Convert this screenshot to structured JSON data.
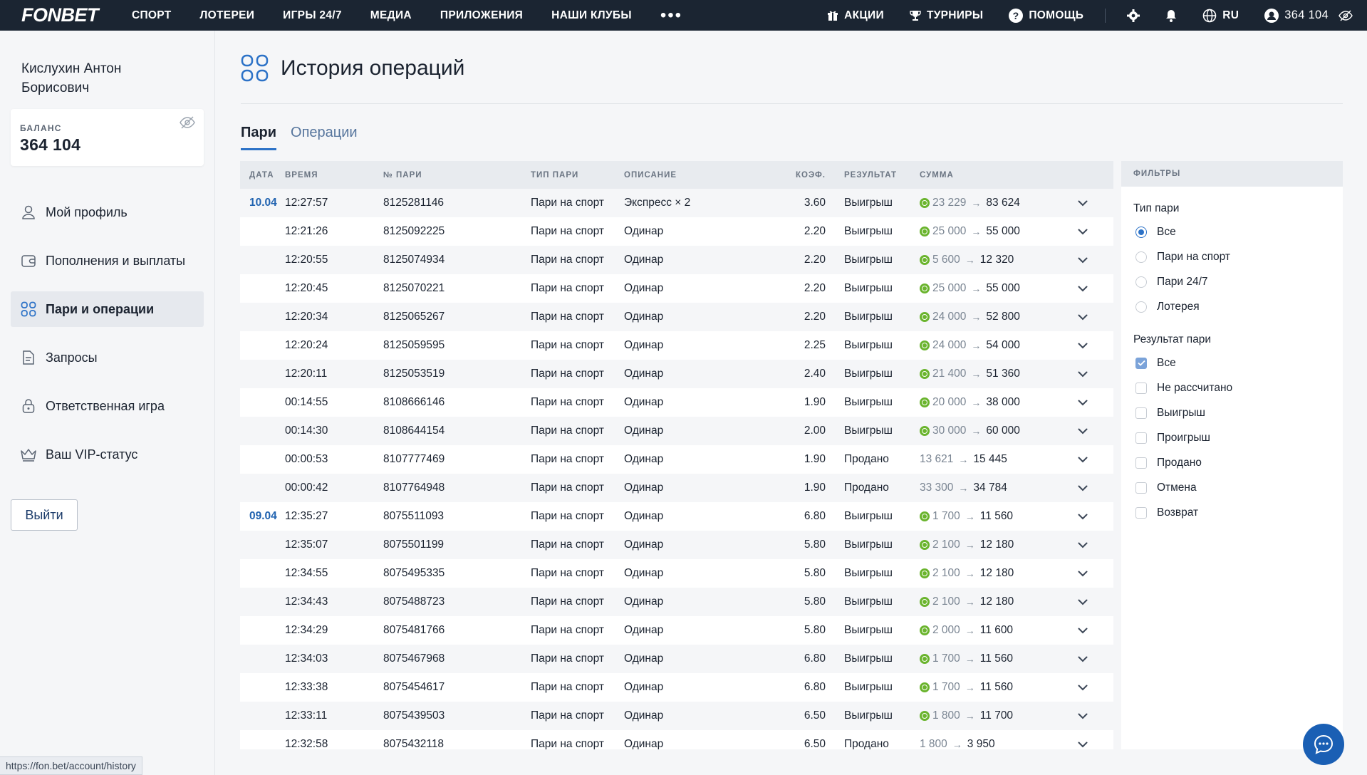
{
  "topbar": {
    "logo": "FONBET",
    "nav": [
      "СПОРТ",
      "ЛОТЕРЕИ",
      "ИГРЫ 24/7",
      "МЕДИА",
      "ПРИЛОЖЕНИЯ",
      "НАШИ КЛУБЫ"
    ],
    "more": "•••",
    "promos": "АКЦИИ",
    "tournaments": "ТУРНИРЫ",
    "help": "ПОМОЩЬ",
    "lang": "RU",
    "balance": "364 104"
  },
  "sidebar": {
    "user_name": "Кислухин Антон Борисович",
    "balance_label": "БАЛАНС",
    "balance_value": "364 104",
    "menu": [
      {
        "label": "Мой профиль",
        "icon": "user-icon"
      },
      {
        "label": "Пополнения и выплаты",
        "icon": "wallet-icon"
      },
      {
        "label": "Пари и операции",
        "icon": "grid-icon",
        "active": true
      },
      {
        "label": "Запросы",
        "icon": "document-icon"
      },
      {
        "label": "Ответственная игра",
        "icon": "lock-icon"
      },
      {
        "label": "Ваш VIP-статус",
        "icon": "crown-icon"
      }
    ],
    "logout": "Выйти"
  },
  "page": {
    "title": "История операций",
    "tabs": [
      "Пари",
      "Операции"
    ]
  },
  "table": {
    "headers": [
      "ДАТА",
      "ВРЕМЯ",
      "№ ПАРИ",
      "ТИП ПАРИ",
      "ОПИСАНИЕ",
      "КОЭФ.",
      "РЕЗУЛЬТАТ",
      "СУММА"
    ],
    "rows": [
      {
        "date": "10.04",
        "time": "12:27:57",
        "num": "8125281146",
        "type": "Пари на спорт",
        "desc": "Экспресс × 2",
        "coef": "3.60",
        "result": "Выигрыш",
        "stake": "23 229",
        "payout": "83 624",
        "bonus": true
      },
      {
        "date": "",
        "time": "12:21:26",
        "num": "8125092225",
        "type": "Пари на спорт",
        "desc": "Одинар",
        "coef": "2.20",
        "result": "Выигрыш",
        "stake": "25 000",
        "payout": "55 000",
        "bonus": true
      },
      {
        "date": "",
        "time": "12:20:55",
        "num": "8125074934",
        "type": "Пари на спорт",
        "desc": "Одинар",
        "coef": "2.20",
        "result": "Выигрыш",
        "stake": "5 600",
        "payout": "12 320",
        "bonus": true
      },
      {
        "date": "",
        "time": "12:20:45",
        "num": "8125070221",
        "type": "Пари на спорт",
        "desc": "Одинар",
        "coef": "2.20",
        "result": "Выигрыш",
        "stake": "25 000",
        "payout": "55 000",
        "bonus": true
      },
      {
        "date": "",
        "time": "12:20:34",
        "num": "8125065267",
        "type": "Пари на спорт",
        "desc": "Одинар",
        "coef": "2.20",
        "result": "Выигрыш",
        "stake": "24 000",
        "payout": "52 800",
        "bonus": true
      },
      {
        "date": "",
        "time": "12:20:24",
        "num": "8125059595",
        "type": "Пари на спорт",
        "desc": "Одинар",
        "coef": "2.25",
        "result": "Выигрыш",
        "stake": "24 000",
        "payout": "54 000",
        "bonus": true
      },
      {
        "date": "",
        "time": "12:20:11",
        "num": "8125053519",
        "type": "Пари на спорт",
        "desc": "Одинар",
        "coef": "2.40",
        "result": "Выигрыш",
        "stake": "21 400",
        "payout": "51 360",
        "bonus": true
      },
      {
        "date": "",
        "time": "00:14:55",
        "num": "8108666146",
        "type": "Пари на спорт",
        "desc": "Одинар",
        "coef": "1.90",
        "result": "Выигрыш",
        "stake": "20 000",
        "payout": "38 000",
        "bonus": true
      },
      {
        "date": "",
        "time": "00:14:30",
        "num": "8108644154",
        "type": "Пари на спорт",
        "desc": "Одинар",
        "coef": "2.00",
        "result": "Выигрыш",
        "stake": "30 000",
        "payout": "60 000",
        "bonus": true
      },
      {
        "date": "",
        "time": "00:00:53",
        "num": "8107777469",
        "type": "Пари на спорт",
        "desc": "Одинар",
        "coef": "1.90",
        "result": "Продано",
        "stake": "13 621",
        "payout": "15 445",
        "bonus": false
      },
      {
        "date": "",
        "time": "00:00:42",
        "num": "8107764948",
        "type": "Пари на спорт",
        "desc": "Одинар",
        "coef": "1.90",
        "result": "Продано",
        "stake": "33 300",
        "payout": "34 784",
        "bonus": false
      },
      {
        "date": "09.04",
        "time": "12:35:27",
        "num": "8075511093",
        "type": "Пари на спорт",
        "desc": "Одинар",
        "coef": "6.80",
        "result": "Выигрыш",
        "stake": "1 700",
        "payout": "11 560",
        "bonus": true
      },
      {
        "date": "",
        "time": "12:35:07",
        "num": "8075501199",
        "type": "Пари на спорт",
        "desc": "Одинар",
        "coef": "5.80",
        "result": "Выигрыш",
        "stake": "2 100",
        "payout": "12 180",
        "bonus": true
      },
      {
        "date": "",
        "time": "12:34:55",
        "num": "8075495335",
        "type": "Пари на спорт",
        "desc": "Одинар",
        "coef": "5.80",
        "result": "Выигрыш",
        "stake": "2 100",
        "payout": "12 180",
        "bonus": true
      },
      {
        "date": "",
        "time": "12:34:43",
        "num": "8075488723",
        "type": "Пари на спорт",
        "desc": "Одинар",
        "coef": "5.80",
        "result": "Выигрыш",
        "stake": "2 100",
        "payout": "12 180",
        "bonus": true
      },
      {
        "date": "",
        "time": "12:34:29",
        "num": "8075481766",
        "type": "Пари на спорт",
        "desc": "Одинар",
        "coef": "5.80",
        "result": "Выигрыш",
        "stake": "2 000",
        "payout": "11 600",
        "bonus": true
      },
      {
        "date": "",
        "time": "12:34:03",
        "num": "8075467968",
        "type": "Пари на спорт",
        "desc": "Одинар",
        "coef": "6.80",
        "result": "Выигрыш",
        "stake": "1 700",
        "payout": "11 560",
        "bonus": true
      },
      {
        "date": "",
        "time": "12:33:38",
        "num": "8075454617",
        "type": "Пари на спорт",
        "desc": "Одинар",
        "coef": "6.80",
        "result": "Выигрыш",
        "stake": "1 700",
        "payout": "11 560",
        "bonus": true
      },
      {
        "date": "",
        "time": "12:33:11",
        "num": "8075439503",
        "type": "Пари на спорт",
        "desc": "Одинар",
        "coef": "6.50",
        "result": "Выигрыш",
        "stake": "1 800",
        "payout": "11 700",
        "bonus": true
      },
      {
        "date": "",
        "time": "12:32:58",
        "num": "8075432118",
        "type": "Пари на спорт",
        "desc": "Одинар",
        "coef": "6.50",
        "result": "Продано",
        "stake": "1 800",
        "payout": "3 950",
        "bonus": false
      }
    ]
  },
  "filters": {
    "title": "ФИЛЬТРЫ",
    "bet_type_title": "Тип пари",
    "bet_types": [
      {
        "label": "Все",
        "selected": true
      },
      {
        "label": "Пари на спорт",
        "selected": false
      },
      {
        "label": "Пари 24/7",
        "selected": false
      },
      {
        "label": "Лотерея",
        "selected": false
      }
    ],
    "result_title": "Результат пари",
    "results": [
      {
        "label": "Все",
        "checked": true
      },
      {
        "label": "Не рассчитано",
        "checked": false
      },
      {
        "label": "Выигрыш",
        "checked": false
      },
      {
        "label": "Проигрыш",
        "checked": false
      },
      {
        "label": "Продано",
        "checked": false
      },
      {
        "label": "Отмена",
        "checked": false
      },
      {
        "label": "Возврат",
        "checked": false
      }
    ]
  },
  "status_url": "https://fon.bet/account/history",
  "colors": {
    "accent": "#2c72c7",
    "topbar": "#1b2532",
    "bonus_coin": "#6ab42d"
  }
}
